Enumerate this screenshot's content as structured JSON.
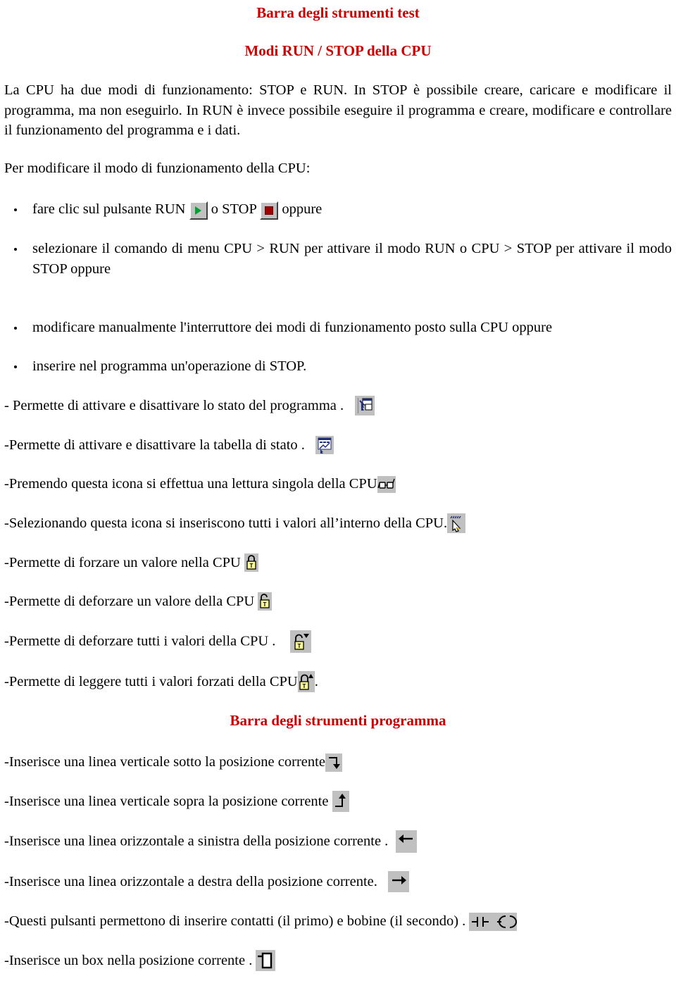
{
  "document": {
    "title": "Barra degli strumenti test",
    "subtitle": "Modi RUN / STOP della CPU",
    "accent_color": "#cc0000",
    "icon_chip_color": "#c0c0c0"
  },
  "intro": {
    "paragraph": "La CPU ha due modi di funzionamento: STOP e RUN. In STOP è possibile creare, caricare e modificare il programma, ma non eseguirlo. In RUN è invece possibile eseguire il programma e creare, modificare e controllare il funzionamento del programma e i dati.",
    "lead_in": "Per modificare il modo di funzionamento della CPU:"
  },
  "bullets": [
    {
      "id": "run-stop",
      "text_before": "fare clic sul pulsante RUN",
      "icon_1": "run-button-icon",
      "text_middle": "o STOP",
      "icon_2": "stop-button-icon",
      "text_after": "oppure"
    },
    {
      "id": "menu-command",
      "text": "selezionare il comando di menu CPU > RUN per attivare il modo RUN o CPU > STOP per attivare il modo STOP oppure"
    },
    {
      "id": "manual-switch",
      "text": "modificare manualmente l'interruttore dei modi di funzionamento posto sulla CPU oppure"
    },
    {
      "id": "stop-operation",
      "text": "inserire nel programma un'operazione di STOP."
    }
  ],
  "icon_rows": [
    {
      "id": "program-status",
      "text": "- Permette di attivare e disattivare lo stato del programma .",
      "icon": "program-status-icon"
    },
    {
      "id": "status-table",
      "text": "-Permette di attivare e disattivare la tabella di stato .",
      "icon": "status-table-icon"
    },
    {
      "id": "single-read",
      "text": "-Premendo questa icona si effettua una lettura singola della CPU",
      "icon": "glasses-single-read-icon"
    },
    {
      "id": "write-all",
      "text": "-Selezionando questa icona si inseriscono tutti i valori all’interno della CPU.",
      "icon": "write-all-values-icon"
    },
    {
      "id": "force-value",
      "text": "-Permette di forzare un valore nella CPU",
      "icon": "force-lock-icon"
    },
    {
      "id": "unforce-value",
      "text": "-Permette di deforzare un valore della CPU",
      "icon": "unforce-lock-icon"
    },
    {
      "id": "unforce-all",
      "text": "-Permette di deforzare tutti i valori della CPU .",
      "icon": "unforce-all-lock-icon"
    },
    {
      "id": "read-forced",
      "text": "-Permette di leggere tutti i valori forzati della CPU",
      "icon": "read-forced-lock-icon",
      "text_after": "."
    }
  ],
  "section_two": {
    "title": "Barra degli strumenti programma",
    "rows": [
      {
        "id": "vline-below",
        "text": "-Inserisce una linea verticale sotto la posizione corrente",
        "icon": "vertical-line-down-icon"
      },
      {
        "id": "vline-above",
        "text": "-Inserisce una linea verticale sopra la posizione corrente",
        "icon": "vertical-line-up-icon"
      },
      {
        "id": "hline-left",
        "text": "-Inserisce una linea orizzontale a sinistra della posizione corrente .",
        "icon": "horizontal-line-left-icon"
      },
      {
        "id": "hline-right",
        "text": "-Inserisce una linea orizzontale a destra della posizione corrente.",
        "icon": "horizontal-line-right-icon"
      },
      {
        "id": "contact-coil",
        "text": "-Questi pulsanti permettono di inserire contatti (il primo) e bobine (il secondo) .",
        "icon": "contact-coil-icon"
      },
      {
        "id": "insert-box",
        "text": "-Inserisce un box nella posizione corrente .",
        "icon": "insert-box-icon"
      }
    ]
  }
}
